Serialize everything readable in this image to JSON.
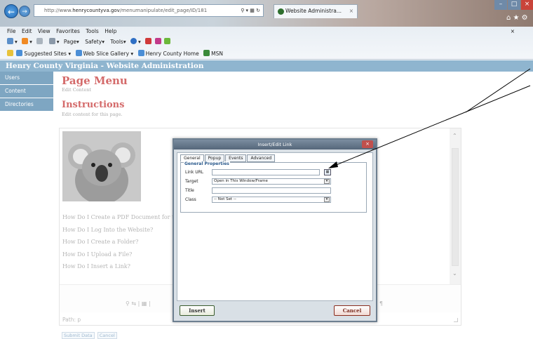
{
  "browser": {
    "address_prefix": "http://www.",
    "address_domain": "henrycountyva.gov",
    "address_path": "/menumanipulate/edit_page/ID/181",
    "tab_title": "Website Administra...",
    "menu": [
      "File",
      "Edit",
      "View",
      "Favorites",
      "Tools",
      "Help"
    ],
    "command_items": [
      "Page",
      "Safety",
      "Tools"
    ],
    "favorites": [
      "Suggested Sites",
      "Web Slice Gallery",
      "Henry County Home",
      "MSN"
    ]
  },
  "site": {
    "header": "Henry County Virginia - Website Administration",
    "sidebar": [
      "Users",
      "Content",
      "Directories"
    ]
  },
  "page": {
    "title": "Page Menu",
    "subtitle": "Edit Content",
    "instructions_title": "Instructions",
    "instructions_text": "Edit content for this page."
  },
  "editor": {
    "links": [
      "How Do I Create a PDF Document for th",
      "How Do I Log Into the Website?",
      "How Do I Create a Folder?",
      "How Do I Upload a File?",
      "How Do I Insert a Link?"
    ],
    "path_label": "Path: p"
  },
  "form_buttons": {
    "submit": "Submit Data",
    "cancel": "Cancel"
  },
  "dialog": {
    "title": "Insert/Edit Link",
    "tabs": [
      "General",
      "Popup",
      "Events",
      "Advanced"
    ],
    "fieldset_legend": "General Properties",
    "link_url_label": "Link URL",
    "link_url_value": "",
    "target_label": "Target",
    "target_value": "Open in This Window/Frame",
    "title_label": "Title",
    "title_value": "",
    "class_label": "Class",
    "class_value": "-- Not Set --",
    "insert_label": "Insert",
    "cancel_label": "Cancel"
  },
  "colors": {
    "header": "#8fb5cf",
    "sidebar": "#7ea6c2",
    "title_red": "#d46a6a",
    "annotation_arrow": "#000000"
  }
}
